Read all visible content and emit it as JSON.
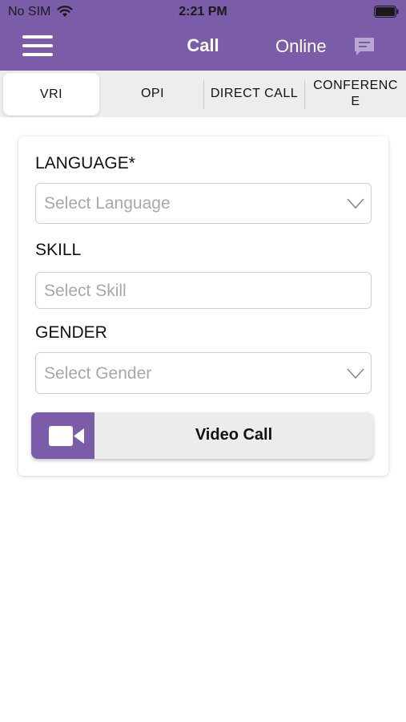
{
  "status_bar": {
    "carrier": "No SIM",
    "time": "2:21 PM"
  },
  "header": {
    "title": "Call",
    "status": "Online"
  },
  "tabs": [
    {
      "label": "VRI",
      "active": true
    },
    {
      "label": "OPI",
      "active": false
    },
    {
      "label": "DIRECT CALL",
      "active": false
    },
    {
      "label": "CONFERENC\nE",
      "active": false
    }
  ],
  "form": {
    "language_label": "LANGUAGE*",
    "language_placeholder": "Select Language",
    "skill_label": "SKILL",
    "skill_placeholder": "Select Skill",
    "gender_label": "GENDER",
    "gender_placeholder": "Select Gender",
    "video_call_label": "Video Call"
  },
  "colors": {
    "accent": "#7b5ca8"
  }
}
